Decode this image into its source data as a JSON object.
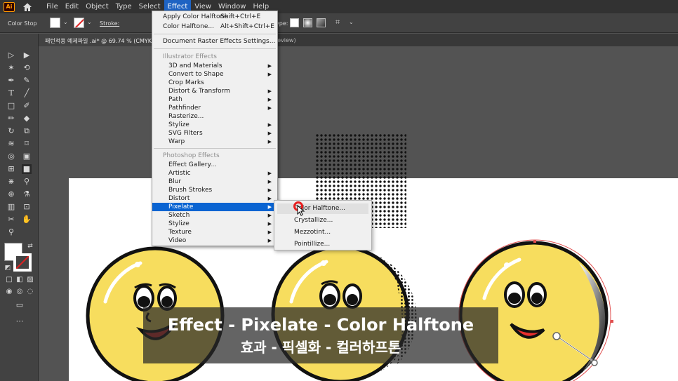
{
  "app": {
    "logo": "Ai",
    "home_icon": "home-icon"
  },
  "menubar": {
    "items": [
      "File",
      "Edit",
      "Object",
      "Type",
      "Select",
      "Effect",
      "View",
      "Window",
      "Help"
    ],
    "active": "Effect"
  },
  "controlbar": {
    "label": "Color Stop",
    "stroke_label": "Stroke:",
    "type_label": "ype:"
  },
  "document": {
    "tab_title": "패턴적용 예제파일 .ai* @ 69.74 % (CMYK",
    "tab2_suffix": "review)"
  },
  "effect_menu": {
    "apply_last": {
      "label": "Apply Color Halftone",
      "shortcut": "Shift+Ctrl+E"
    },
    "last_effect": {
      "label": "Color Halftone...",
      "shortcut": "Alt+Shift+Ctrl+E"
    },
    "raster_settings": "Document Raster Effects Settings...",
    "illustrator_header": "Illustrator Effects",
    "illustrator_items": [
      {
        "label": "3D and Materials",
        "submenu": true
      },
      {
        "label": "Convert to Shape",
        "submenu": true
      },
      {
        "label": "Crop Marks",
        "submenu": false
      },
      {
        "label": "Distort & Transform",
        "submenu": true
      },
      {
        "label": "Path",
        "submenu": true
      },
      {
        "label": "Pathfinder",
        "submenu": true
      },
      {
        "label": "Rasterize...",
        "submenu": false
      },
      {
        "label": "Stylize",
        "submenu": true
      },
      {
        "label": "SVG Filters",
        "submenu": true
      },
      {
        "label": "Warp",
        "submenu": true
      }
    ],
    "photoshop_header": "Photoshop Effects",
    "photoshop_items": [
      {
        "label": "Effect Gallery...",
        "submenu": false
      },
      {
        "label": "Artistic",
        "submenu": true
      },
      {
        "label": "Blur",
        "submenu": true
      },
      {
        "label": "Brush Strokes",
        "submenu": true
      },
      {
        "label": "Distort",
        "submenu": true
      },
      {
        "label": "Pixelate",
        "submenu": true,
        "highlighted": true
      },
      {
        "label": "Sketch",
        "submenu": true
      },
      {
        "label": "Stylize",
        "submenu": true
      },
      {
        "label": "Texture",
        "submenu": true
      },
      {
        "label": "Video",
        "submenu": true
      }
    ],
    "arrow_glyph": "▶"
  },
  "pixelate_submenu": {
    "items": [
      "Color Halftone...",
      "Crystallize...",
      "Mezzotint...",
      "Pointillize..."
    ],
    "hovered": "Color Halftone..."
  },
  "caption": {
    "line1": "Effect - Pixelate - Color Halftone",
    "line2": "효과 - 픽셀화 - 컬러하프톤"
  },
  "colors": {
    "accent": "#0a64d2",
    "face_yellow": "#f7dd5e",
    "outline": "#111111",
    "cursor": "#e81e1e"
  }
}
